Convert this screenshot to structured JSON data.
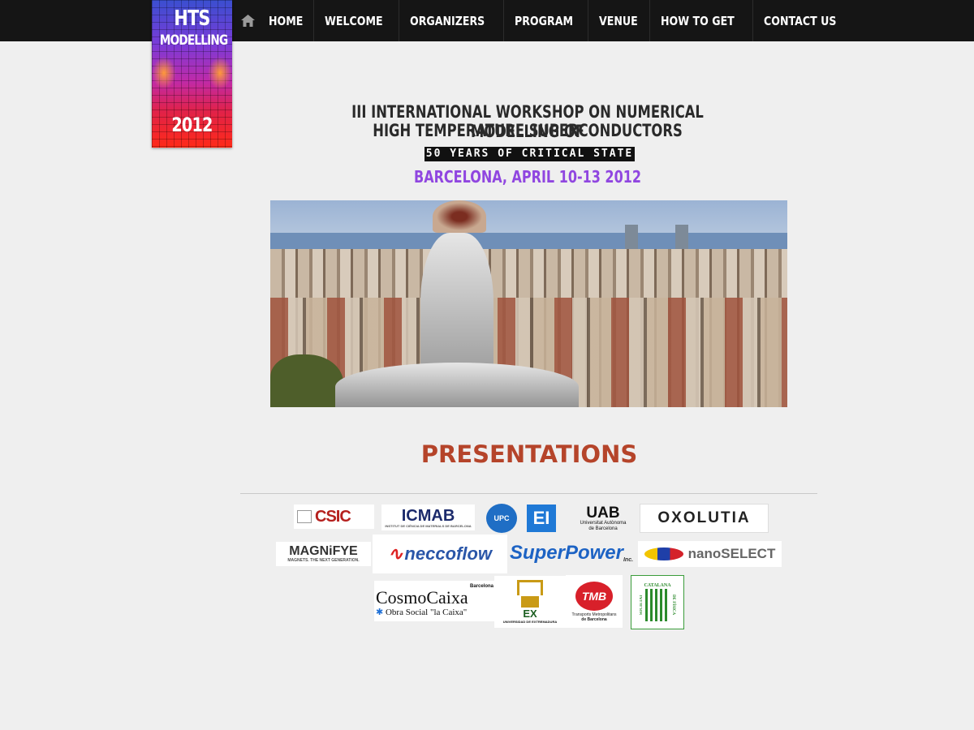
{
  "logo": {
    "line1": "HTS",
    "line2": "MODELLING",
    "year": "2012"
  },
  "nav": {
    "home_icon": "home-icon",
    "items": [
      "HOME",
      "WELCOME",
      "ORGANIZERS",
      "PROGRAM",
      "VENUE",
      "HOW TO GET",
      "CONTACT US"
    ]
  },
  "workshop": {
    "title_line1": "III INTERNATIONAL WORKSHOP ON NUMERICAL MODELLING OF",
    "title_line2": "HIGH TEMPERATURE SUPERCONDUCTORS",
    "tagline": "50 YEARS OF CRITICAL STATE",
    "dates": "BARCELONA, APRIL 10-13 2012"
  },
  "page": {
    "heading": "PRESENTATIONS"
  },
  "sponsors": {
    "csic": "CSIC",
    "icmab": "ICMAB",
    "icmab_sub": "INSTITUT DE CIÈNCIA DE MATERIALS DE BARCELONA",
    "upc": "UPC",
    "ei": "EI",
    "uab": "UAB",
    "uab_sub1": "Universitat Autònoma",
    "uab_sub2": "de Barcelona",
    "oxolutia": "OXOLUTIA",
    "magnifye": "MAGNiFYE",
    "magnifye_sub": "MAGNETS. THE NEXT GENERATION.",
    "neccoflow": "neccoflow",
    "superpower": "SuperPower",
    "superpower_sub": "Inc.",
    "nanoselect": "nanoSELECT",
    "cosmocaixa_city": "Barcelona",
    "cosmocaixa": "CosmoCaixa",
    "cosmocaixa_sub": "Obra Social \"la Caixa\"",
    "uex": "EX",
    "uex_sub": "UNIVERSIDAD DE EXTREMADURA",
    "tmb": "TMB",
    "tmb_sub1": "Transports Metropolitans",
    "tmb_sub2": "de Barcelona",
    "scf1": "SOCIETAT",
    "scf2": "CATALANA",
    "scf3": "DE FÍSICA"
  },
  "colors": {
    "accent": "#b5442a",
    "dates": "#9046e0",
    "topbar": "#151515"
  }
}
